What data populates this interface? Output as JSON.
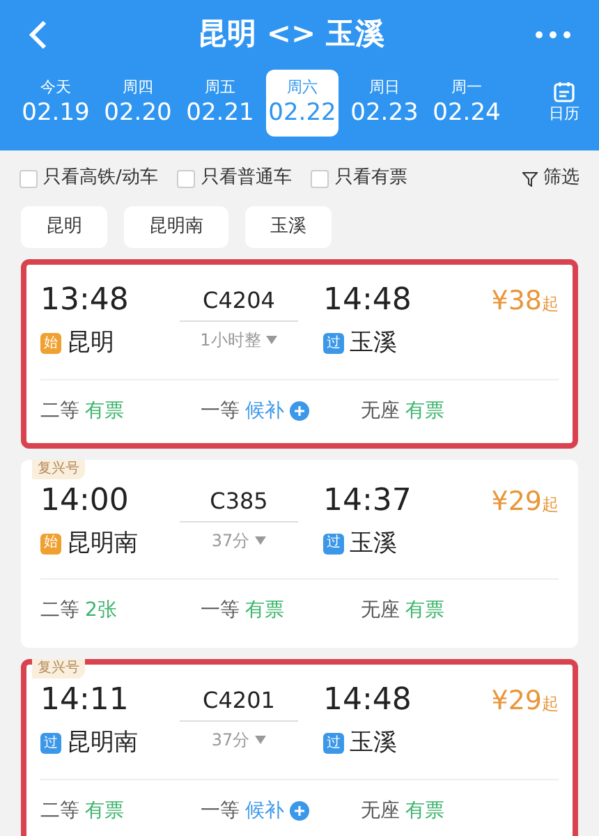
{
  "header": {
    "title": "昆明 <> 玉溪"
  },
  "dates": [
    {
      "weekday": "今天",
      "date": "02.19",
      "selected": false
    },
    {
      "weekday": "周四",
      "date": "02.20",
      "selected": false
    },
    {
      "weekday": "周五",
      "date": "02.21",
      "selected": false
    },
    {
      "weekday": "周六",
      "date": "02.22",
      "selected": true
    },
    {
      "weekday": "周日",
      "date": "02.23",
      "selected": false
    },
    {
      "weekday": "周一",
      "date": "02.24",
      "selected": false
    }
  ],
  "calendar": {
    "label": "日历"
  },
  "filters": [
    {
      "label": "只看高铁/动车",
      "checked": false
    },
    {
      "label": "只看普通车",
      "checked": false
    },
    {
      "label": "只看有票",
      "checked": false
    }
  ],
  "filter_button": "筛选",
  "stations": [
    "昆明",
    "昆明南",
    "玉溪"
  ],
  "trains": [
    {
      "highlighted": true,
      "depart": "13:48",
      "number": "C4204",
      "arrive": "14:48",
      "from_tag": {
        "kind": "start",
        "text": "始"
      },
      "from": "昆明",
      "duration": "1小时整",
      "to_tag": {
        "kind": "pass",
        "text": "过"
      },
      "to": "玉溪",
      "price": "¥38",
      "price_suffix": "起",
      "seats": [
        {
          "class": "二等",
          "status": "有票",
          "kind": "available"
        },
        {
          "class": "一等",
          "status": "候补",
          "kind": "waitlist"
        },
        {
          "class": "无座",
          "status": "有票",
          "kind": "available"
        }
      ]
    },
    {
      "highlighted": false,
      "badge": "复兴号",
      "depart": "14:00",
      "number": "C385",
      "arrive": "14:37",
      "from_tag": {
        "kind": "start",
        "text": "始"
      },
      "from": "昆明南",
      "duration": "37分",
      "to_tag": {
        "kind": "pass",
        "text": "过"
      },
      "to": "玉溪",
      "price": "¥29",
      "price_suffix": "起",
      "seats": [
        {
          "class": "二等",
          "status": "2张",
          "kind": "available"
        },
        {
          "class": "一等",
          "status": "有票",
          "kind": "available"
        },
        {
          "class": "无座",
          "status": "有票",
          "kind": "available"
        }
      ]
    },
    {
      "highlighted": true,
      "badge": "复兴号",
      "depart": "14:11",
      "number": "C4201",
      "arrive": "14:48",
      "from_tag": {
        "kind": "pass",
        "text": "过"
      },
      "from": "昆明南",
      "duration": "37分",
      "to_tag": {
        "kind": "pass",
        "text": "过"
      },
      "to": "玉溪",
      "price": "¥29",
      "price_suffix": "起",
      "seats": [
        {
          "class": "二等",
          "status": "有票",
          "kind": "available"
        },
        {
          "class": "一等",
          "status": "候补",
          "kind": "waitlist"
        },
        {
          "class": "无座",
          "status": "有票",
          "kind": "available"
        }
      ]
    }
  ]
}
